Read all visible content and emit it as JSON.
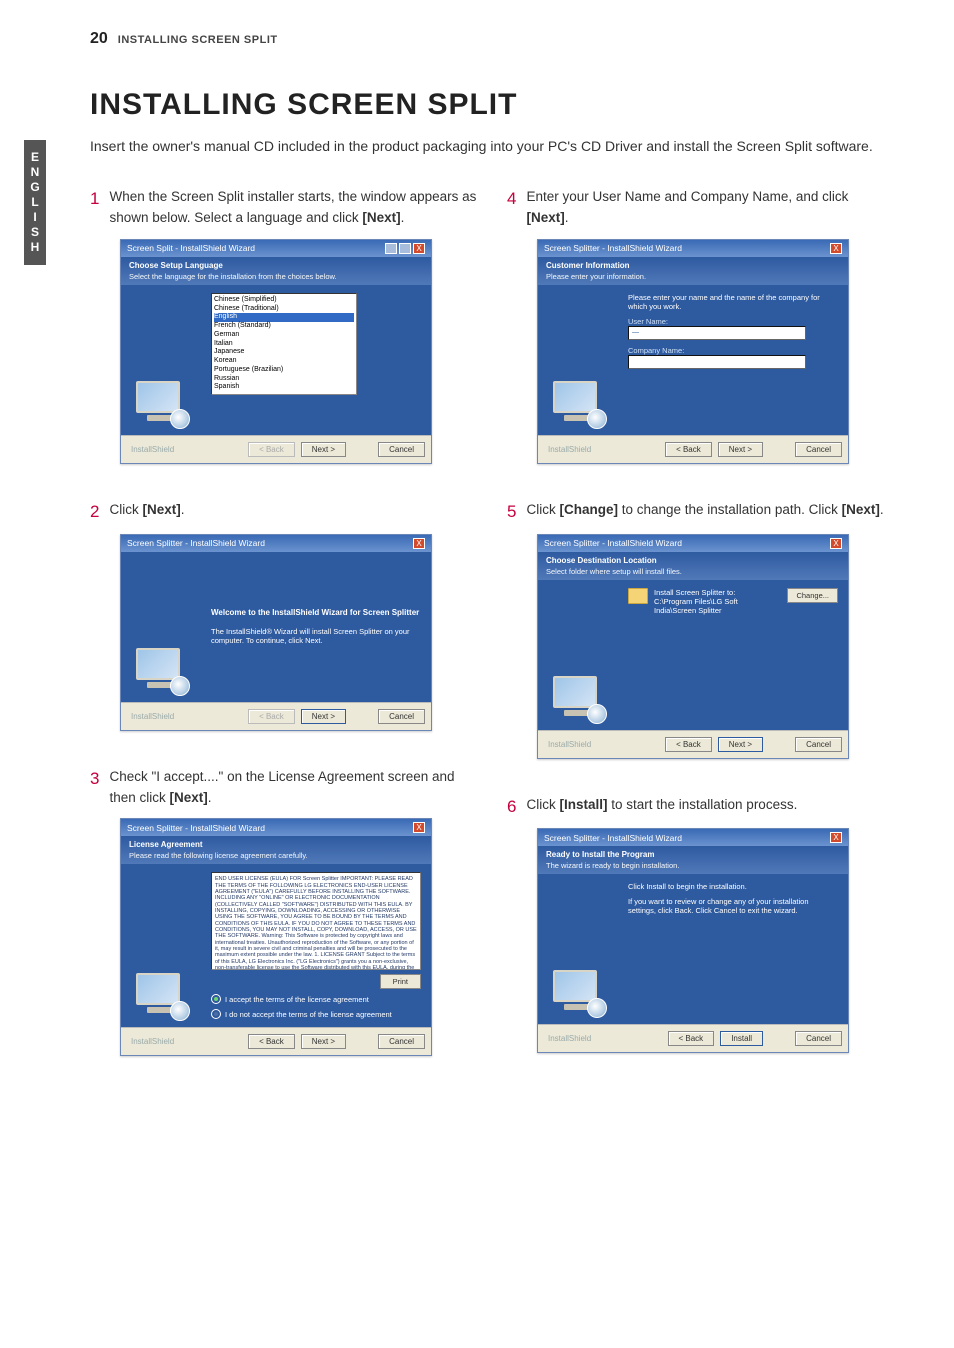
{
  "page": {
    "number": "20",
    "running_header": "INSTALLING SCREEN SPLIT",
    "side_tab": "ENGLISH",
    "title": "INSTALLING SCREEN SPLIT",
    "intro": "Insert the owner's manual CD included in the product packaging into your PC's CD Driver and install the Screen Split software."
  },
  "steps": {
    "s1": {
      "num": "1",
      "text_a": "When the Screen Split installer starts, the window appears as shown below. Select a language and click ",
      "bold": "[Next]",
      "text_b": "."
    },
    "s2": {
      "num": "2",
      "text_a": "Click ",
      "bold": "[Next]",
      "text_b": "."
    },
    "s3": {
      "num": "3",
      "text_a": "Check \"I accept....\" on the License Agreement screen and then click ",
      "bold": "[Next]",
      "text_b": "."
    },
    "s4": {
      "num": "4",
      "text_a": "Enter your User Name and Company Name, and click ",
      "bold": "[Next]",
      "text_b": "."
    },
    "s5": {
      "num": "5",
      "text_a": "Click ",
      "bold": "[Change]",
      "text_b": " to change the installation path. Click ",
      "bold2": "[Next]",
      "text_c": "."
    },
    "s6": {
      "num": "6",
      "text_a": "Click ",
      "bold": "[Install]",
      "text_b": " to start the installation process."
    }
  },
  "wizard_common": {
    "brand": "InstallShield",
    "back": "< Back",
    "next": "Next >",
    "cancel": "Cancel",
    "install": "Install",
    "close_x": "X"
  },
  "wiz1": {
    "title": "Screen Split - InstallShield Wizard",
    "sub_title": "Choose Setup Language",
    "sub_desc": "Select the language for the installation from the choices below.",
    "langs": [
      "Chinese (Simplified)",
      "Chinese (Traditional)",
      "English",
      "French (Standard)",
      "German",
      "Italian",
      "Japanese",
      "Korean",
      "Portuguese (Brazilian)",
      "Russian",
      "Spanish"
    ],
    "selected_lang_index": 2
  },
  "wiz2": {
    "title": "Screen Splitter - InstallShield Wizard",
    "heading": "Welcome to the InstallShield Wizard for Screen Splitter",
    "body": "The InstallShield® Wizard will install Screen Splitter on your computer. To continue, click Next."
  },
  "wiz3": {
    "title": "Screen Splitter - InstallShield Wizard",
    "sub_title": "License Agreement",
    "sub_desc": "Please read the following license agreement carefully.",
    "eula": "END USER LICENSE (EULA) FOR Screen Splitter\nIMPORTANT: PLEASE READ THE TERMS OF THE FOLLOWING LG ELECTRONICS END-USER LICENSE AGREEMENT (\"EULA\") CAREFULLY BEFORE INSTALLING THE SOFTWARE. INCLUDING ANY \"ONLINE\" OR ELECTRONIC DOCUMENTATION (COLLECTIVELY CALLED \"SOFTWARE\") DISTRIBUTED WITH THIS EULA. BY INSTALLING, COPYING, DOWNLOADING, ACCESSING OR OTHERWISE USING THE SOFTWARE, YOU AGREE TO BE BOUND BY THE TERMS AND CONDITIONS OF THIS EULA. IF YOU DO NOT AGREE TO THESE TERMS AND CONDITIONS, YOU MAY NOT INSTALL, COPY, DOWNLOAD, ACCESS, OR USE THE SOFTWARE.\nWarning: This Software is protected by copyright laws and international treaties. Unauthorized reproduction of the Software, or any portion of it, may result in severe civil and criminal penalties and will be prosecuted to the maximum extent possible under the law.\n\n1. LICENSE GRANT\nSubject to the terms of this EULA, LG Electronics Inc. (\"LG Electronics\") grants you a non-exclusive, non-transferable license to use the Software distributed with this EULA, during the term of this EULA solely (a) in machine-readable, object-code form, (b) on a single computer owned, leased or controlled by you, (c) in connection with your use of the LG LCD monitor product with which the Software has been provided to you and (d) for your business or personal purposes exclusively for your internal use only. You may make one copy of the Software in machine-readable form for backup purposes only. The backup copy must include",
    "accept": "I accept the terms of the license agreement",
    "reject": "I do not accept the terms of the license agreement",
    "print": "Print"
  },
  "wiz4": {
    "title": "Screen Splitter - InstallShield Wizard",
    "sub_title": "Customer Information",
    "sub_desc": "Please enter your information.",
    "prompt": "Please enter your name and the name of the company for which you work.",
    "user_label": "User Name:",
    "user_value": "—",
    "company_label": "Company Name:"
  },
  "wiz5": {
    "title": "Screen Splitter - InstallShield Wizard",
    "sub_title": "Choose Destination Location",
    "sub_desc": "Select folder where setup will install files.",
    "dest_label": "Install Screen Splitter to:",
    "dest_path": "C:\\Program Files\\LG Soft India\\Screen Splitter",
    "change": "Change..."
  },
  "wiz6": {
    "title": "Screen Splitter - InstallShield Wizard",
    "sub_title": "Ready to Install the Program",
    "sub_desc": "The wizard is ready to begin installation.",
    "line1": "Click Install to begin the installation.",
    "line2": "If you want to review or change any of your installation settings, click Back. Click Cancel to exit the wizard."
  }
}
